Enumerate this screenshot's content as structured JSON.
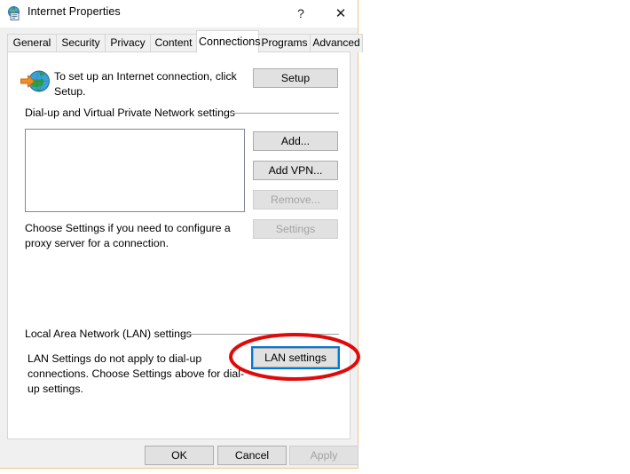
{
  "window": {
    "title": "Internet Properties",
    "icon": "internet-properties-icon",
    "help_label": "?",
    "close_label": "✕"
  },
  "tabs": [
    {
      "label": "General",
      "active": false
    },
    {
      "label": "Security",
      "active": false
    },
    {
      "label": "Privacy",
      "active": false
    },
    {
      "label": "Content",
      "active": false
    },
    {
      "label": "Connections",
      "active": true
    },
    {
      "label": "Programs",
      "active": false
    },
    {
      "label": "Advanced",
      "active": false
    }
  ],
  "panel": {
    "intro": {
      "icon": "globe-with-arrow-icon",
      "text": "To set up an Internet connection, click Setup.",
      "setup_button": "Setup"
    },
    "dialup_group": {
      "legend": "Dial-up and Virtual Private Network settings",
      "listbox_items": [],
      "buttons": [
        {
          "label": "Add...",
          "enabled": true
        },
        {
          "label": "Add VPN...",
          "enabled": true
        },
        {
          "label": "Remove...",
          "enabled": false
        },
        {
          "label": "Settings",
          "enabled": false
        }
      ],
      "note": "Choose Settings if you need to configure a proxy server for a connection."
    },
    "lan_group": {
      "legend": "Local Area Network (LAN) settings",
      "note": "LAN Settings do not apply to dial-up connections. Choose Settings above for dial-up settings.",
      "button": "LAN settings",
      "button_focused": true
    }
  },
  "footer": {
    "buttons": [
      {
        "label": "OK",
        "enabled": true
      },
      {
        "label": "Cancel",
        "enabled": true
      },
      {
        "label": "Apply",
        "enabled": false
      }
    ]
  },
  "annotation": {
    "shape": "red-ellipse-highlight",
    "color": "#e00a0a",
    "target": "LAN settings"
  },
  "colors": {
    "window_background": "#f0f0f0",
    "panel_background": "#ffffff",
    "button_face": "#e1e1e1",
    "button_border": "#adadad",
    "focus_blue": "#0078d7",
    "disabled_text": "#a3a3a3",
    "window_border": "#f2c58a"
  }
}
